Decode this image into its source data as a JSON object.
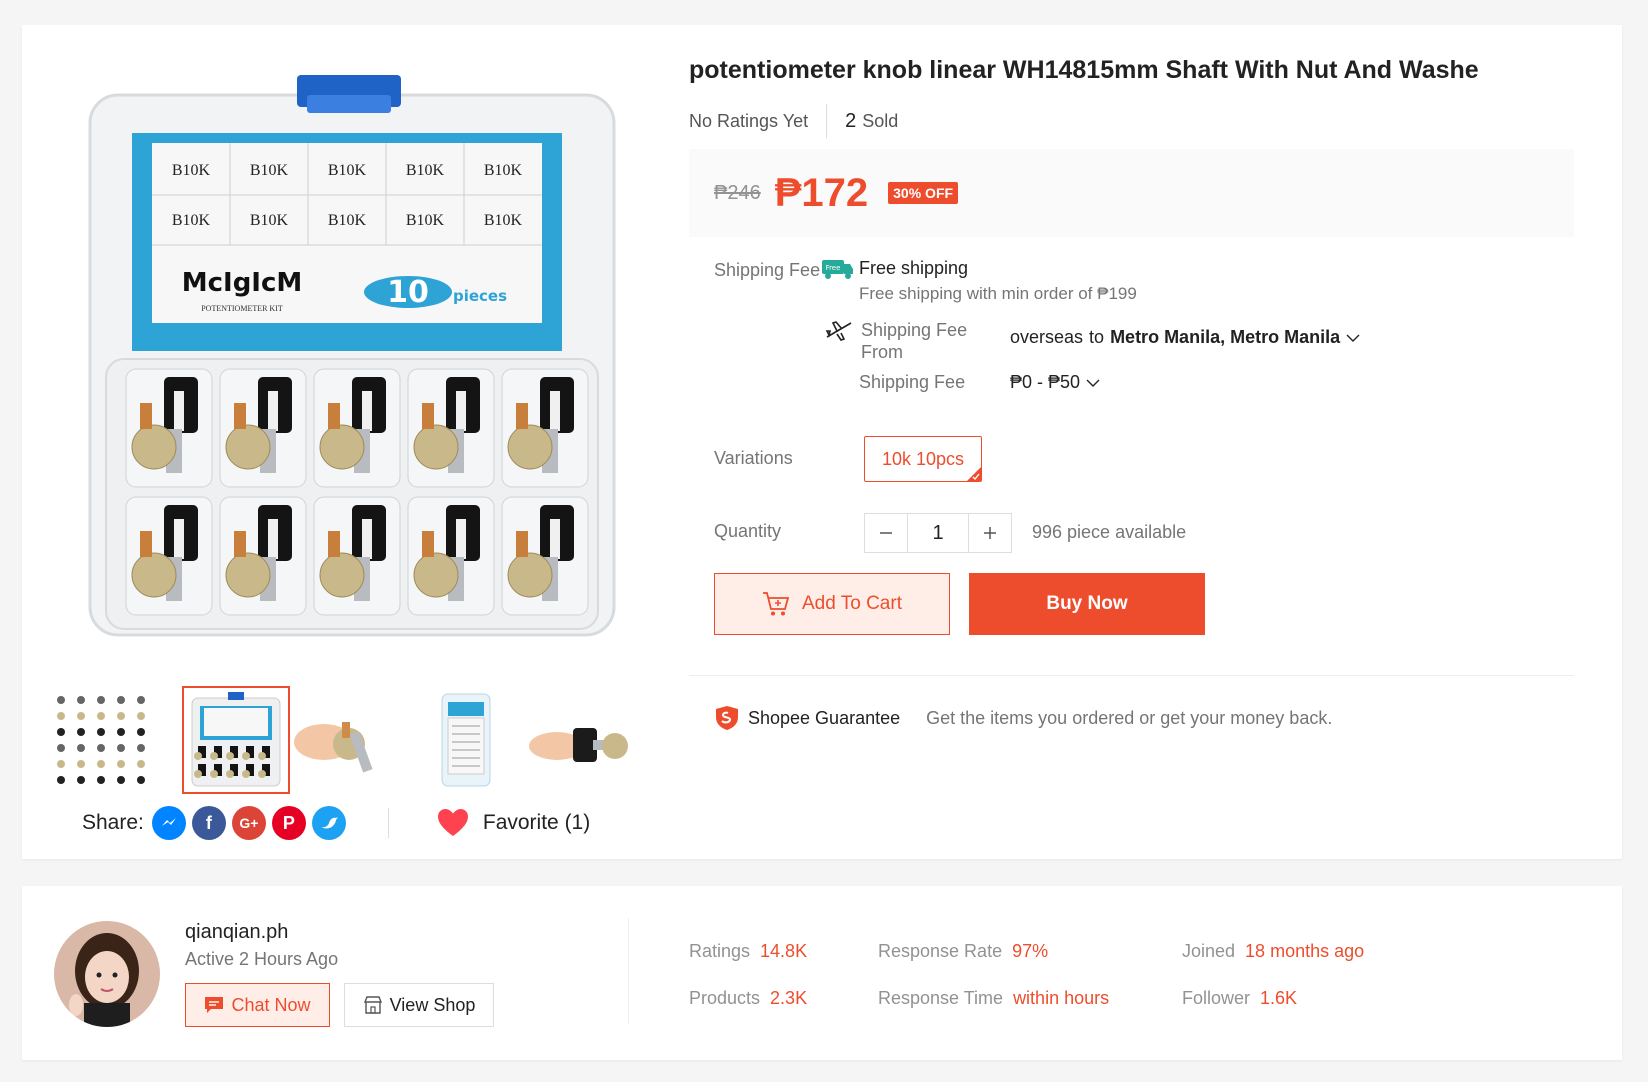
{
  "product": {
    "title": "potentiometer knob linear WH14815mm Shaft With Nut And Washe",
    "ratings_text": "No Ratings Yet",
    "sold_count": "2",
    "sold_label": "Sold",
    "original_price": "₱246",
    "price": "₱172",
    "discount": "30% OFF"
  },
  "gallery": {
    "thumbnail_count": 5,
    "active_thumbnail_index": 1,
    "kit_labels": [
      "B10K",
      "B10K",
      "B10K",
      "B10K",
      "B10K",
      "B10K",
      "B10K",
      "B10K",
      "B10K",
      "B10K"
    ],
    "brand": "McIgIcM",
    "kit_name": "POTENTIOMETER KIT",
    "pieces_number": "10",
    "pieces_label": "pieces"
  },
  "share": {
    "label": "Share:",
    "networks": [
      "messenger-icon",
      "facebook-icon",
      "google-plus-icon",
      "pinterest-icon",
      "twitter-icon"
    ]
  },
  "favorite": {
    "label": "Favorite (1)"
  },
  "shipping": {
    "label": "Shipping Fee",
    "free_icon_text": "Free",
    "free_title": "Free shipping",
    "free_note": "Free shipping with min order of ₱199",
    "from_label": "Shipping Fee From",
    "from_origin": "overseas",
    "to_word": "to",
    "destination": "Metro Manila, Metro Manila",
    "fee_label": "Shipping Fee",
    "fee_range": "₱0 - ₱50"
  },
  "variations": {
    "label": "Variations",
    "options": [
      "10k 10pcs"
    ],
    "selected": "10k 10pcs"
  },
  "quantity": {
    "label": "Quantity",
    "value": "1",
    "available": "996 piece available"
  },
  "actions": {
    "add_to_cart": "Add To Cart",
    "buy_now": "Buy Now"
  },
  "guarantee": {
    "title": "Shopee Guarantee",
    "text": "Get the items you ordered or get your money back."
  },
  "shop": {
    "name": "qianqian.ph",
    "active": "Active 2 Hours Ago",
    "chat_label": "Chat Now",
    "view_label": "View Shop",
    "stats": {
      "ratings_label": "Ratings",
      "ratings_value": "14.8K",
      "products_label": "Products",
      "products_value": "2.3K",
      "response_rate_label": "Response Rate",
      "response_rate_value": "97%",
      "response_time_label": "Response Time",
      "response_time_value": "within hours",
      "joined_label": "Joined",
      "joined_value": "18 months ago",
      "follower_label": "Follower",
      "follower_value": "1.6K"
    }
  },
  "colors": {
    "brand": "#ee4d2d",
    "teal": "#26aa99",
    "kit_blue": "#2ea3d6"
  }
}
